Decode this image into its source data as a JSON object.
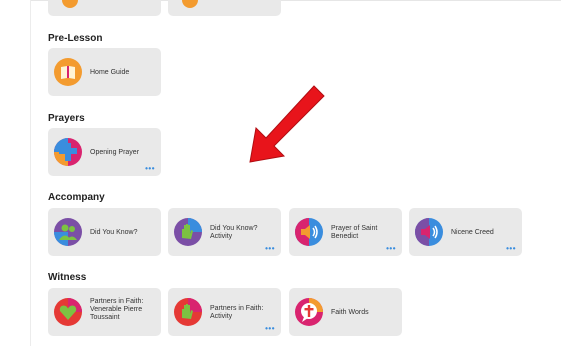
{
  "sections": {
    "pre_lesson": {
      "title": "Pre-Lesson",
      "cards": [
        {
          "label": "Home Guide",
          "icon": "book-icon",
          "has_more": false
        }
      ]
    },
    "prayers": {
      "title": "Prayers",
      "cards": [
        {
          "label": "Opening Prayer",
          "icon": "cross-icon",
          "has_more": true
        }
      ]
    },
    "accompany": {
      "title": "Accompany",
      "cards": [
        {
          "label": "Did You Know?",
          "icon": "people-icon",
          "has_more": false
        },
        {
          "label": "Did You Know? Activity",
          "icon": "hand-icon",
          "has_more": true
        },
        {
          "label": "Prayer of Saint Benedict",
          "icon": "speaker-icon",
          "has_more": true
        },
        {
          "label": "Nicene Creed",
          "icon": "speaker-icon",
          "has_more": true
        }
      ]
    },
    "witness": {
      "title": "Witness",
      "cards": [
        {
          "label": "Partners in Faith: Venerable Pierre Toussaint",
          "icon": "heart-icon",
          "has_more": false
        },
        {
          "label": "Partners in Faith: Activity",
          "icon": "hand-icon",
          "has_more": true
        },
        {
          "label": "Faith Words",
          "icon": "cross-speech-icon",
          "has_more": false
        }
      ]
    }
  },
  "more_glyph": "•••",
  "annotation": {
    "icon": "red-arrow-icon",
    "color": "#e8141b"
  },
  "colors": {
    "card_bg": "#e9e9e9",
    "accent_blue": "#3a8dde",
    "orange": "#f39b2f",
    "purple": "#7b4fa6",
    "magenta": "#d9246f",
    "green": "#7cc242",
    "red": "#e53935"
  }
}
